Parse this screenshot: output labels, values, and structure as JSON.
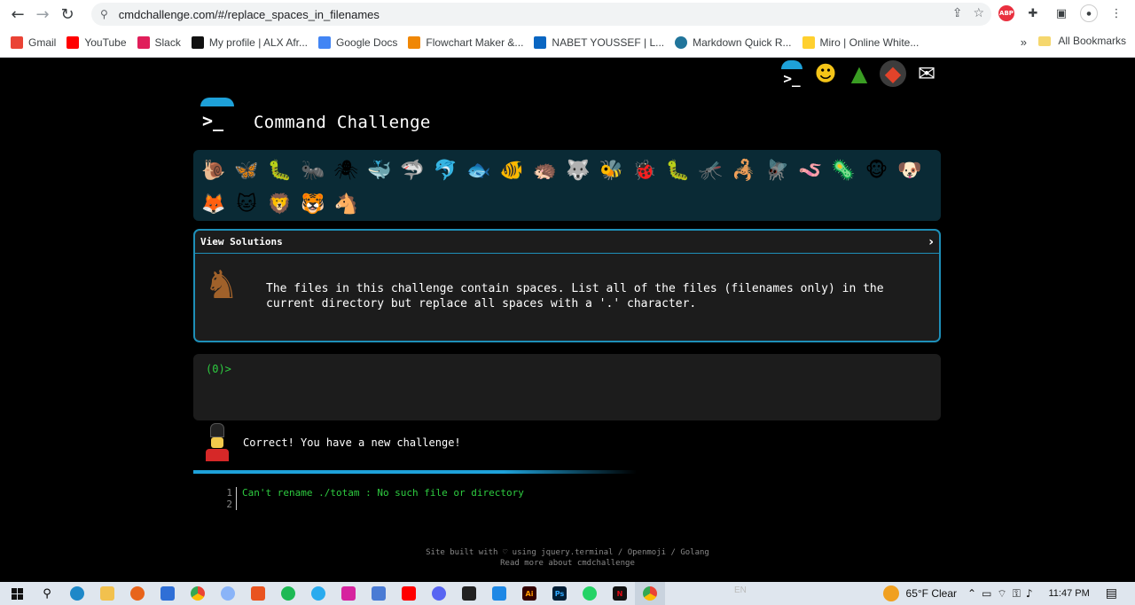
{
  "browser": {
    "url": "cmdchallenge.com/#/replace_spaces_in_filenames",
    "bookmarks": [
      {
        "label": "Gmail",
        "color": "#ea4335"
      },
      {
        "label": "YouTube",
        "color": "#ff0000"
      },
      {
        "label": "Slack",
        "color": "#4a154b"
      },
      {
        "label": "My profile | ALX Afr...",
        "color": "#111111"
      },
      {
        "label": "Google Docs",
        "color": "#4285f4"
      },
      {
        "label": "Flowchart Maker &...",
        "color": "#f08705"
      },
      {
        "label": "NABET YOUSSEF | L...",
        "color": "#0a66c2"
      },
      {
        "label": "Markdown Quick R...",
        "color": "#21759b"
      },
      {
        "label": "Miro | Online White...",
        "color": "#ffd02f"
      }
    ],
    "bookmarks_more": "»",
    "all_bookmarks": "All Bookmarks",
    "abp_label": "ABP"
  },
  "page": {
    "title": "Command Challenge",
    "top_icons": [
      "terminal-icon",
      "thinking-face-icon",
      "tree-icon",
      "gitlab-icon",
      "mail-icon"
    ],
    "challenge_icons": [
      "🐌",
      "🦋",
      "🐛",
      "🐜",
      "🕷",
      "🐳",
      "🦈",
      "🐬",
      "🐟",
      "🐠",
      "🦔",
      "🐺",
      "🐝",
      "🐞",
      "🐛",
      "🦟",
      "🦂",
      "🪰",
      "🪱",
      "🦠",
      "🐵",
      "🐶",
      "🦊",
      "🐱",
      "🦁",
      "🐯",
      "🐴"
    ],
    "view_solutions": "View Solutions",
    "chevron": "›",
    "description": "The files in this challenge contain spaces. List all of the files (filenames only) in the current directory but replace all spaces with a '.' character.",
    "prompt": "(0)>",
    "correct_message": "Correct! You have a new challenge!",
    "output_lines": [
      {
        "num": "1",
        "text": "Can't rename ./totam : No such file or directory"
      },
      {
        "num": "2",
        "text": ""
      }
    ],
    "footer_line1": "Site built with ♡ using jquery.terminal / Openmoji / Golang",
    "footer_line2": "Read more about cmdchallenge"
  },
  "taskbar": {
    "weather": "65°F  Clear",
    "time": "11:47 PM",
    "lang": "EN"
  }
}
